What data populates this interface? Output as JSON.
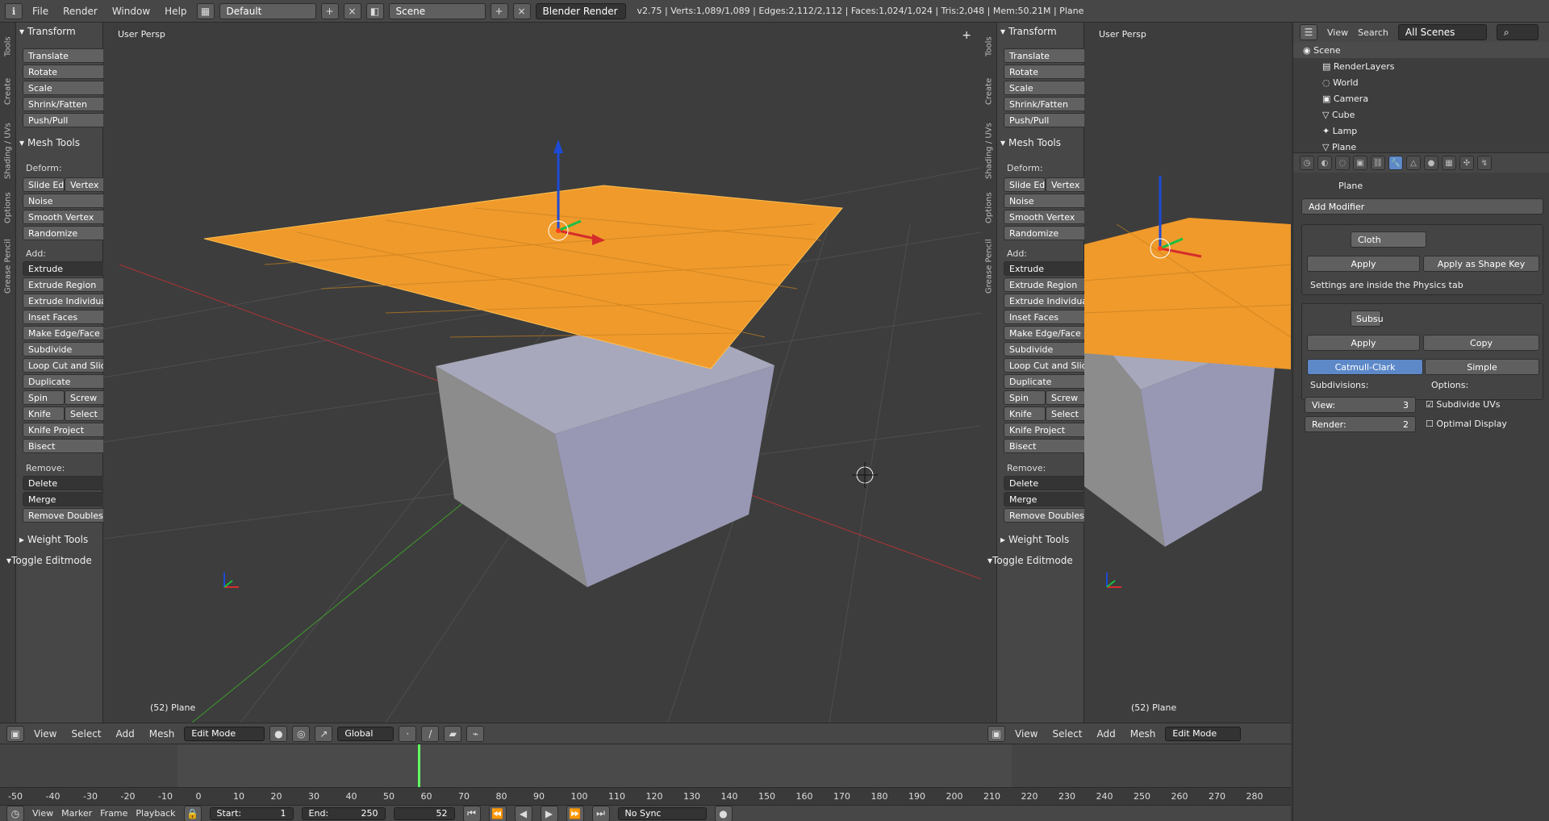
{
  "top_bar": {
    "menus": [
      "File",
      "Render",
      "Window",
      "Help"
    ],
    "layout": "Default",
    "scene": "Scene",
    "render_engine": "Blender Render",
    "stats": "v2.75 | Verts:1,089/1,089 | Edges:2,112/2,112 | Faces:1,024/1,024 | Tris:2,048 | Mem:50.21M | Plane"
  },
  "left_panel": {
    "tabs": [
      "Tools",
      "Create",
      "Shading / UVs",
      "Options",
      "Grease Pencil"
    ],
    "transform": "Transform",
    "transform_items": [
      "Translate",
      "Rotate",
      "Scale",
      "Shrink/Fatten",
      "Push/Pull"
    ],
    "mesh_tools": "Mesh Tools",
    "deform": "Deform:",
    "deform_items": [
      "Slide Ed",
      "Vertex",
      "Noise",
      "Smooth Vertex",
      "Randomize"
    ],
    "add": "Add:",
    "add_items": [
      "Extrude",
      "Extrude Region",
      "Extrude Individual",
      "Inset Faces",
      "Make Edge/Face",
      "Subdivide",
      "Loop Cut and Slide",
      "Duplicate",
      "Spin",
      "Screw",
      "Knife",
      "Select",
      "Knife Project",
      "Bisect"
    ],
    "remove": "Remove:",
    "remove_items": [
      "Delete",
      "Merge",
      "Remove Doubles"
    ],
    "weight_tools": "Weight Tools",
    "toggle_editmode": "Toggle Editmode"
  },
  "viewport": {
    "label": "User Persp",
    "status": "(52) Plane"
  },
  "viewport_header": {
    "menus": [
      "View",
      "Select",
      "Add",
      "Mesh"
    ],
    "mode": "Edit Mode",
    "orientation": "Global"
  },
  "outliner": {
    "menus": [
      "View",
      "Search"
    ],
    "scope": "All Scenes",
    "items": [
      "Scene",
      "RenderLayers",
      "World",
      "Camera",
      "Cube",
      "Lamp",
      "Plane"
    ]
  },
  "properties": {
    "object": "Plane",
    "add_modifier": "Add Modifier",
    "cloth_name": "Cloth",
    "apply": "Apply",
    "apply_shape_key": "Apply as Shape Key",
    "physics_note": "Settings are inside the Physics tab",
    "subsurf_name": "Subsu",
    "copy": "Copy",
    "catmull": "Catmull-Clark",
    "simple": "Simple",
    "subdivisions": "Subdivisions:",
    "options": "Options:",
    "view_label": "View:",
    "view_value": "3",
    "render_label": "Render:",
    "render_value": "2",
    "subdivide_uvs": "Subdivide UVs",
    "optimal_display": "Optimal Display"
  },
  "timeline": {
    "ticks": [
      "-50",
      "-40",
      "-30",
      "-20",
      "-10",
      "0",
      "10",
      "20",
      "30",
      "40",
      "50",
      "60",
      "70",
      "80",
      "90",
      "100",
      "110",
      "120",
      "130",
      "140",
      "150",
      "160",
      "170",
      "180",
      "190",
      "200",
      "210",
      "220",
      "230",
      "240",
      "250",
      "260",
      "270",
      "280"
    ],
    "menus": [
      "View",
      "Marker",
      "Frame",
      "Playback"
    ],
    "start": "Start:",
    "start_value": "1",
    "end": "End:",
    "end_value": "250",
    "current_frame": "52",
    "sync": "No Sync"
  }
}
